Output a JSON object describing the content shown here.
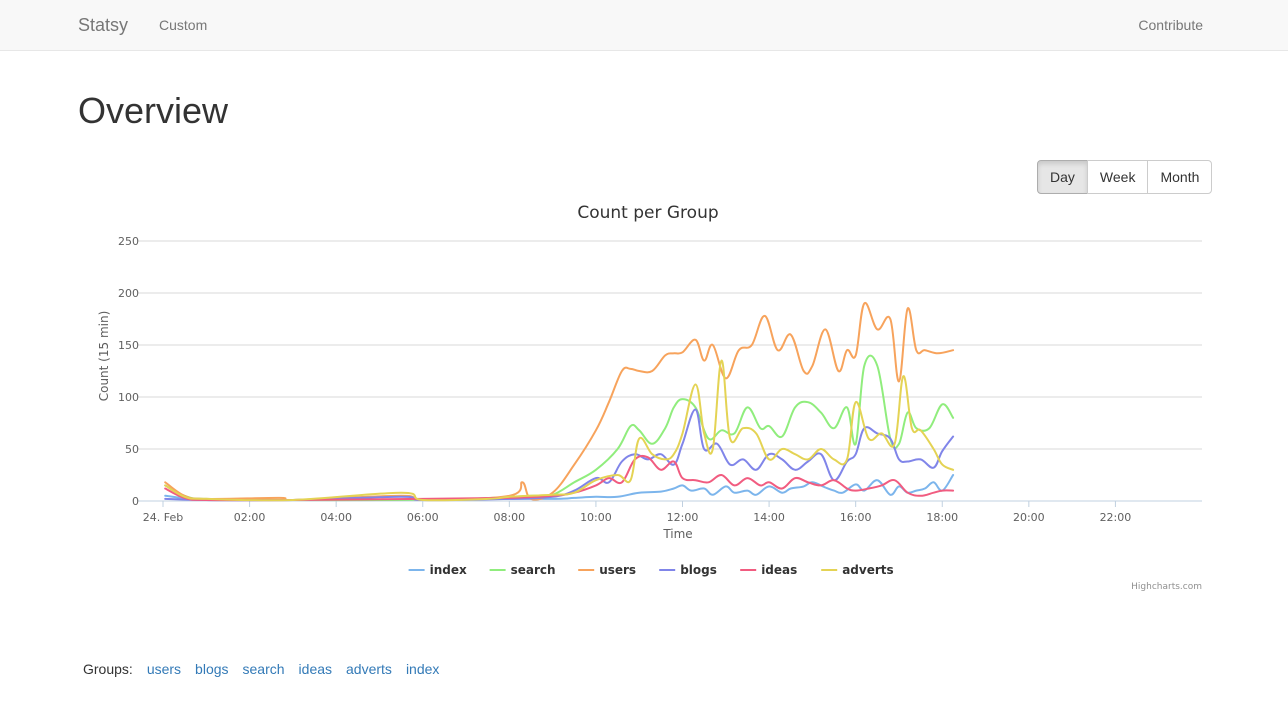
{
  "navbar": {
    "brand": "Statsy",
    "links": [
      {
        "label": "Custom"
      }
    ],
    "right_link": "Contribute"
  },
  "page": {
    "title": "Overview"
  },
  "range_buttons": {
    "day": "Day",
    "week": "Week",
    "month": "Month",
    "active": "Day"
  },
  "groups": {
    "label": "Groups:",
    "links": [
      "users",
      "blogs",
      "search",
      "ideas",
      "adverts",
      "index"
    ]
  },
  "chart_data": {
    "type": "line",
    "title": "Count per Group",
    "xlabel": "Time",
    "ylabel": "Count (15 min)",
    "ylim": [
      0,
      250
    ],
    "yticks": [
      0,
      50,
      100,
      150,
      200,
      250
    ],
    "xlim": [
      0,
      24
    ],
    "xtick_values": [
      0,
      2,
      4,
      6,
      8,
      10,
      12,
      14,
      16,
      18,
      20,
      22
    ],
    "xtick_labels": [
      "24. Feb",
      "02:00",
      "04:00",
      "06:00",
      "08:00",
      "10:00",
      "12:00",
      "14:00",
      "16:00",
      "18:00",
      "20:00",
      "22:00"
    ],
    "grid": true,
    "legend_position": "bottom",
    "credits": "Highcharts.com",
    "series": [
      {
        "name": "index",
        "color": "#7cb5ec",
        "x": [
          0.05,
          1.0,
          3.0,
          5.0,
          7.0,
          9.0,
          9.5,
          10.0,
          10.5,
          11.0,
          11.5,
          11.8,
          12.0,
          12.2,
          12.5,
          12.7,
          13.0,
          13.2,
          13.5,
          13.7,
          14.0,
          14.3,
          14.5,
          14.8,
          15.0,
          15.3,
          15.5,
          15.7,
          16.0,
          16.2,
          16.5,
          16.8,
          17.0,
          17.2,
          17.4,
          17.6,
          17.8,
          18.0,
          18.25
        ],
        "y": [
          5,
          1,
          1,
          1,
          2,
          2,
          3,
          4,
          4,
          8,
          9,
          12,
          15,
          10,
          12,
          6,
          14,
          8,
          10,
          6,
          14,
          8,
          12,
          14,
          18,
          13,
          10,
          8,
          16,
          10,
          20,
          6,
          14,
          8,
          10,
          12,
          18,
          10,
          25
        ]
      },
      {
        "name": "search",
        "color": "#90ed7d",
        "x": [
          0.05,
          0.5,
          1.0,
          3.0,
          5.0,
          7.0,
          8.5,
          9.0,
          9.5,
          10.0,
          10.5,
          10.8,
          11.0,
          11.3,
          11.6,
          11.8,
          12.0,
          12.3,
          12.6,
          12.9,
          13.2,
          13.5,
          13.8,
          14.0,
          14.3,
          14.6,
          14.9,
          15.2,
          15.5,
          15.8,
          16.0,
          16.2,
          16.5,
          16.8,
          17.0,
          17.2,
          17.4,
          17.7,
          18.0,
          18.25
        ],
        "y": [
          15,
          5,
          2,
          1,
          1,
          2,
          5,
          6,
          18,
          30,
          50,
          72,
          68,
          55,
          70,
          90,
          98,
          90,
          60,
          68,
          65,
          90,
          70,
          72,
          62,
          90,
          95,
          85,
          70,
          90,
          55,
          130,
          130,
          60,
          55,
          85,
          70,
          70,
          93,
          80
        ]
      },
      {
        "name": "users",
        "color": "#f7a35c",
        "x": [
          0.05,
          0.5,
          1.0,
          2.7,
          3.0,
          5.5,
          6.0,
          8.0,
          8.3,
          8.5,
          9.0,
          9.5,
          10.0,
          10.3,
          10.6,
          10.8,
          11.0,
          11.3,
          11.6,
          11.8,
          12.0,
          12.3,
          12.5,
          12.7,
          13.0,
          13.3,
          13.6,
          13.9,
          14.2,
          14.5,
          14.8,
          15.0,
          15.3,
          15.6,
          15.8,
          16.0,
          16.2,
          16.5,
          16.8,
          17.0,
          17.2,
          17.4,
          17.6,
          17.9,
          18.25
        ],
        "y": [
          18,
          5,
          2,
          3,
          1,
          5,
          1,
          5,
          18,
          2,
          8,
          35,
          68,
          95,
          125,
          127,
          125,
          125,
          140,
          142,
          143,
          155,
          135,
          150,
          118,
          145,
          150,
          178,
          145,
          160,
          125,
          130,
          165,
          125,
          145,
          140,
          190,
          165,
          175,
          115,
          185,
          145,
          145,
          142,
          145
        ]
      },
      {
        "name": "blogs",
        "color": "#8085e9",
        "x": [
          0.05,
          1.0,
          3.0,
          5.5,
          6.0,
          8.0,
          9.0,
          9.5,
          10.0,
          10.3,
          10.6,
          10.9,
          11.2,
          11.5,
          11.8,
          12.0,
          12.3,
          12.5,
          12.8,
          13.1,
          13.4,
          13.7,
          14.0,
          14.3,
          14.6,
          14.9,
          15.2,
          15.5,
          15.8,
          16.0,
          16.2,
          16.5,
          16.8,
          17.0,
          17.2,
          17.5,
          17.8,
          18.0,
          18.25
        ],
        "y": [
          2,
          1,
          1,
          4,
          1,
          2,
          4,
          10,
          22,
          18,
          38,
          45,
          40,
          45,
          35,
          55,
          88,
          50,
          55,
          35,
          40,
          30,
          45,
          40,
          30,
          38,
          45,
          20,
          38,
          45,
          70,
          65,
          60,
          40,
          38,
          40,
          32,
          48,
          62
        ]
      },
      {
        "name": "ideas",
        "color": "#f15c80",
        "x": [
          0.05,
          0.5,
          1.0,
          3.0,
          6.0,
          8.0,
          9.0,
          9.5,
          10.0,
          10.3,
          10.6,
          10.9,
          11.2,
          11.5,
          11.8,
          12.0,
          12.3,
          12.6,
          12.9,
          13.2,
          13.5,
          13.8,
          14.0,
          14.3,
          14.6,
          14.9,
          15.2,
          15.5,
          15.8,
          16.0,
          16.3,
          16.6,
          16.9,
          17.2,
          17.5,
          17.8,
          18.0,
          18.25
        ],
        "y": [
          12,
          3,
          1,
          1,
          2,
          3,
          5,
          8,
          15,
          22,
          18,
          40,
          42,
          30,
          38,
          22,
          20,
          18,
          25,
          15,
          22,
          15,
          18,
          12,
          22,
          18,
          15,
          20,
          12,
          10,
          12,
          15,
          20,
          8,
          5,
          8,
          10,
          10
        ]
      },
      {
        "name": "adverts",
        "color": "#e4d354",
        "x": [
          0.05,
          0.5,
          1.0,
          3.0,
          5.5,
          6.0,
          7.5,
          8.0,
          9.0,
          9.5,
          10.0,
          10.5,
          10.8,
          11.0,
          11.3,
          11.6,
          11.8,
          12.0,
          12.3,
          12.5,
          12.7,
          12.9,
          13.1,
          13.4,
          13.7,
          14.0,
          14.3,
          14.6,
          14.9,
          15.2,
          15.5,
          15.8,
          16.0,
          16.3,
          16.6,
          16.9,
          17.1,
          17.3,
          17.5,
          17.8,
          18.0,
          18.25
        ],
        "y": [
          15,
          4,
          2,
          1,
          8,
          1,
          2,
          4,
          6,
          8,
          20,
          25,
          20,
          60,
          45,
          40,
          45,
          65,
          112,
          65,
          50,
          135,
          60,
          70,
          65,
          40,
          50,
          45,
          40,
          50,
          40,
          40,
          95,
          60,
          65,
          55,
          120,
          70,
          68,
          50,
          35,
          30
        ]
      }
    ]
  }
}
